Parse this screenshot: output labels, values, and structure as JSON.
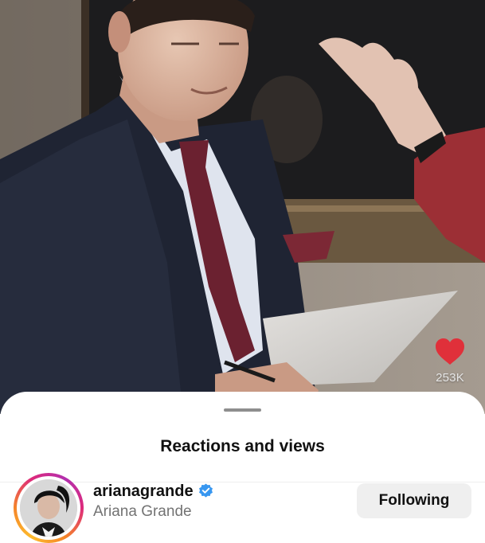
{
  "video": {
    "like_count": "253K",
    "heart_color": "#e0303a"
  },
  "sheet": {
    "title": "Reactions and views"
  },
  "viewers": [
    {
      "username": "arianagrande",
      "full_name": "Ariana Grande",
      "verified": true,
      "follow_label": "Following"
    }
  ],
  "colors": {
    "verified_badge": "#3897f0",
    "secondary_text": "#737373",
    "button_bg": "#efefef"
  }
}
